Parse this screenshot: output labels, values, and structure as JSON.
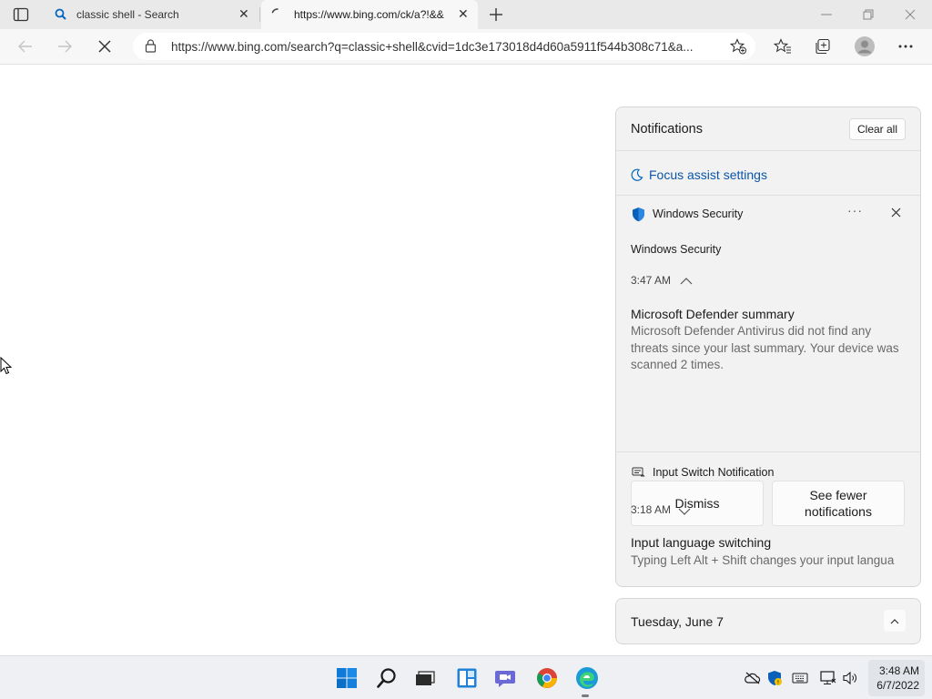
{
  "browser": {
    "tabs": [
      {
        "title": "classic shell - Search",
        "icon": "bing-search-icon"
      },
      {
        "title": "https://www.bing.com/ck/a?!&&",
        "icon": "loading-spinner-icon"
      }
    ],
    "new_tab_icon": "plus-icon",
    "address": "https://www.bing.com/search?q=classic+shell&cvid=1dc3e173018d4d60a5911f544b308c71&a..."
  },
  "notifications": {
    "header": "Notifications",
    "clear_all": "Clear all",
    "focus_assist": "Focus assist settings",
    "security": {
      "app": "Windows Security",
      "group": "Windows Security",
      "time": "3:47 AM",
      "title": "Microsoft Defender summary",
      "body": "Microsoft Defender Antivirus did not find any threats since your last summary. Your device was scanned 2 times.",
      "dismiss": "Dismiss",
      "fewer": "See fewer notifications"
    },
    "input": {
      "app": "Input Switch Notification",
      "time": "3:18 AM",
      "title": "Input language switching",
      "body": "Typing Left Alt + Shift changes your input langua"
    }
  },
  "calendar": {
    "date": "Tuesday, June 7"
  },
  "taskbar": {
    "time": "3:48 AM",
    "date": "6/7/2022"
  },
  "colors": {
    "accent_blue": "#0067c0",
    "taskbar_bg": "#eef0f3",
    "panel_bg": "#f2f2f2"
  }
}
